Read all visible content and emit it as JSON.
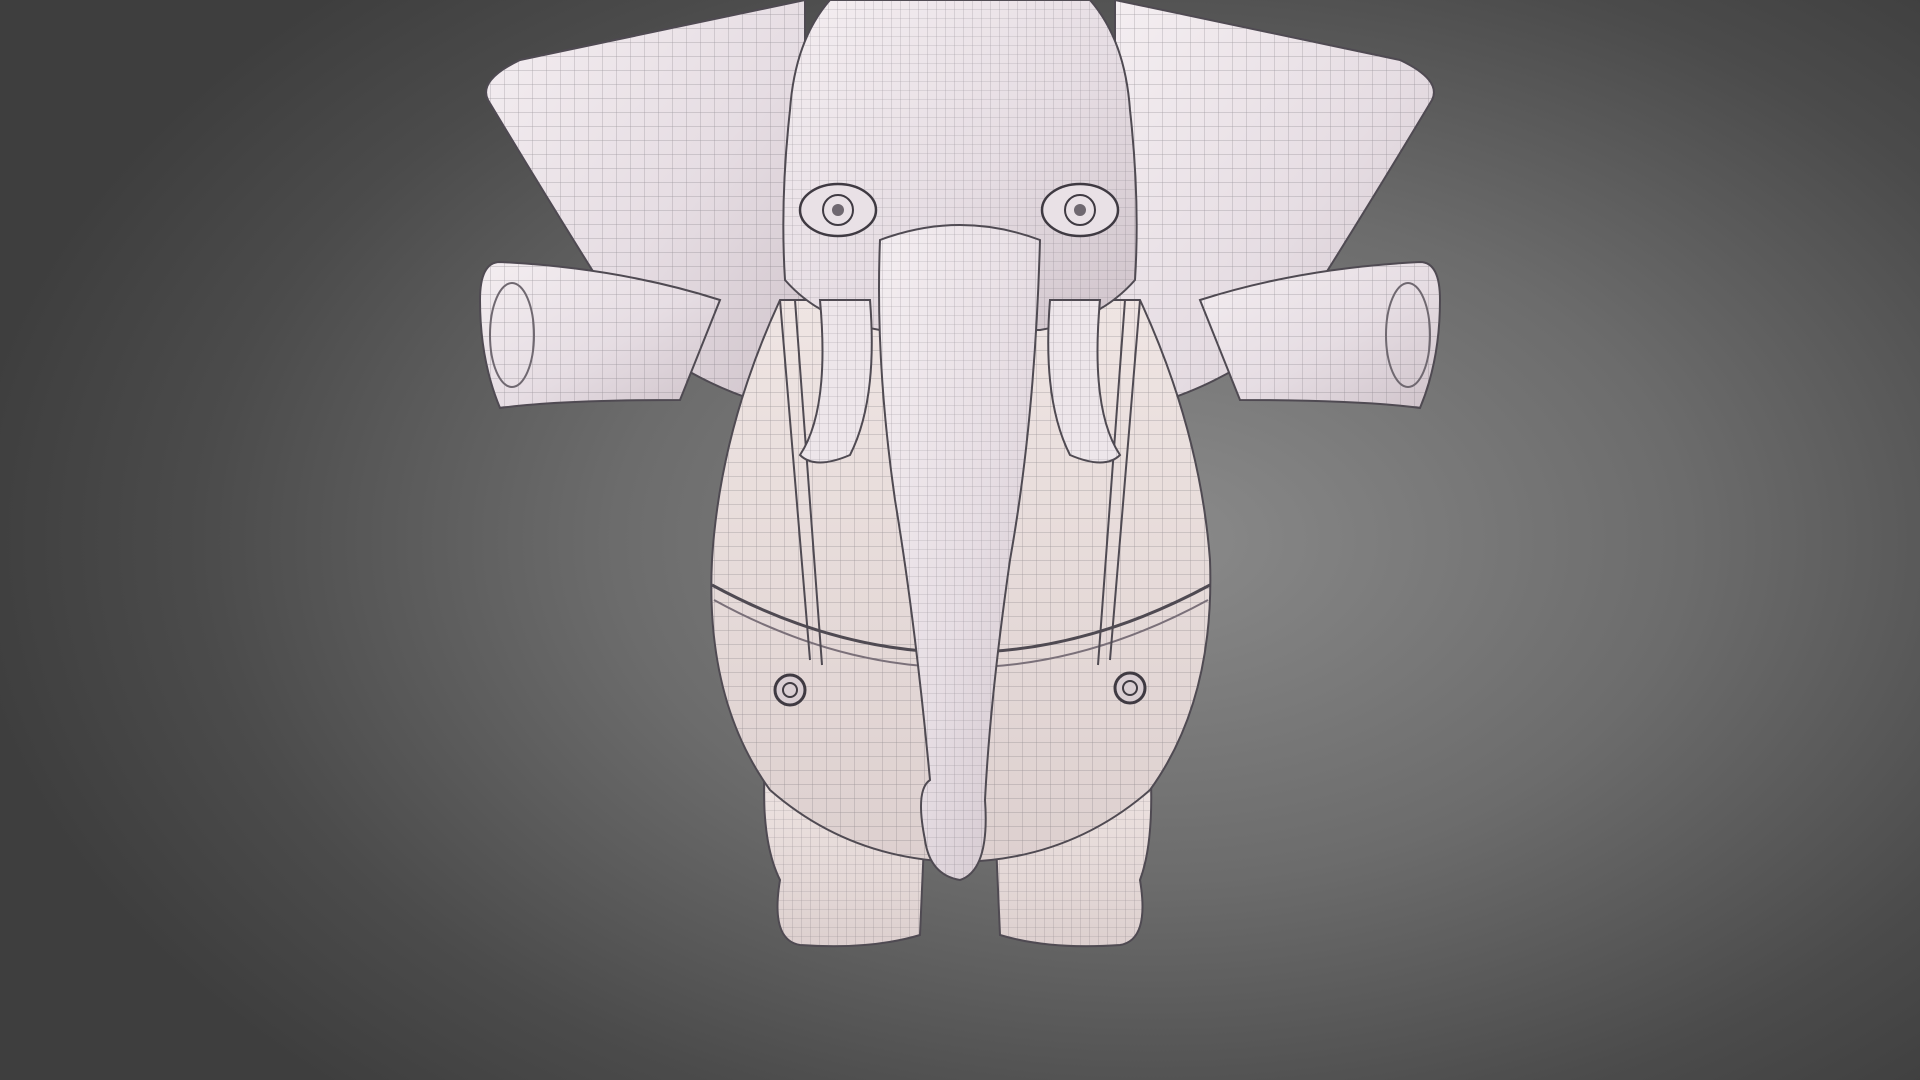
{
  "viewport": {
    "background_center_color": "#8a8a8a",
    "background_edge_color": "#3e3e3e"
  },
  "model": {
    "subject": "elephant-character-wireframe",
    "surface_color": "#efe8ec",
    "wire_color": "#5f5a62",
    "shadow_color": "#c9bfc6"
  }
}
